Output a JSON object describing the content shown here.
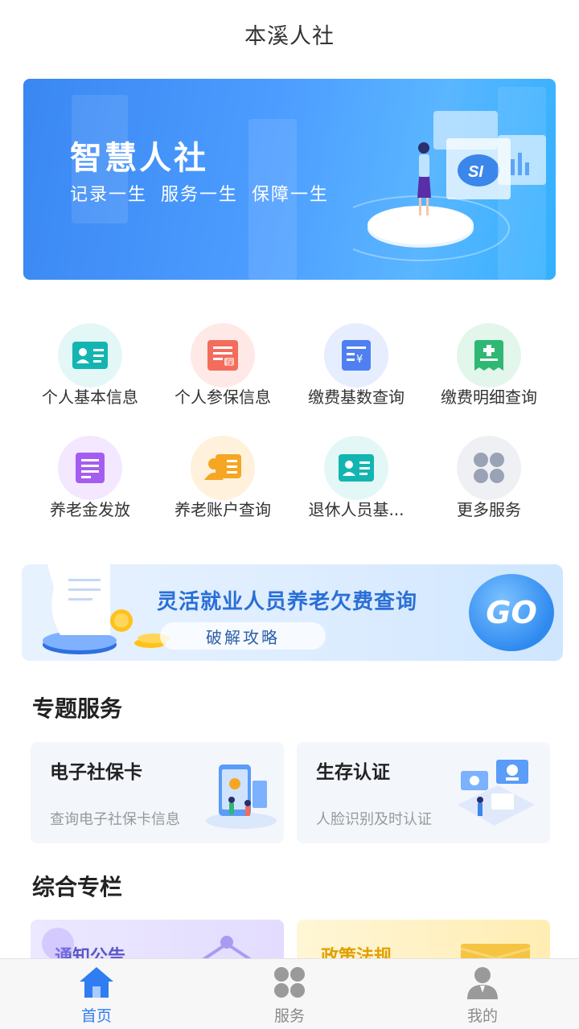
{
  "header": {
    "title": "本溪人社"
  },
  "banner": {
    "headline": "智慧人社",
    "slogan": "记录一生 服务一生 保障一生"
  },
  "services": [
    {
      "label": "个人基本信息",
      "icon": "id-card-icon",
      "bg": "#e3f7f7",
      "color": "#13b5b1"
    },
    {
      "label": "个人参保信息",
      "icon": "insurance-doc-icon",
      "bg": "#ffe9e6",
      "color": "#f36c5c"
    },
    {
      "label": "缴费基数查询",
      "icon": "payment-base-icon",
      "bg": "#e6edff",
      "color": "#4f7ff0"
    },
    {
      "label": "缴费明细查询",
      "icon": "payment-detail-icon",
      "bg": "#e2f6ec",
      "color": "#2fb873"
    },
    {
      "label": "养老金发放",
      "icon": "pension-payout-icon",
      "bg": "#f3e8ff",
      "color": "#a45df0"
    },
    {
      "label": "养老账户查询",
      "icon": "pension-account-icon",
      "bg": "#fff1dc",
      "color": "#f5a623"
    },
    {
      "label": "退休人员基...",
      "icon": "retiree-card-icon",
      "bg": "#e3f7f7",
      "color": "#13b5b1"
    },
    {
      "label": "更多服务",
      "icon": "more-services-icon",
      "bg": "#eef0f4",
      "color": "#9aa3b5"
    }
  ],
  "promo": {
    "title": "灵活就业人员养老欠费查询",
    "button": "破解攻略",
    "go": "GO"
  },
  "topics": {
    "title": "专题服务",
    "cards": [
      {
        "title": "电子社保卡",
        "subtitle": "查询电子社保卡信息"
      },
      {
        "title": "生存认证",
        "subtitle": "人脸识别及时认证"
      }
    ]
  },
  "columns": {
    "title": "综合专栏",
    "cards": [
      {
        "title": "通知公告",
        "color": "#5b58c9"
      },
      {
        "title": "政策法规",
        "color": "#e0a000"
      }
    ]
  },
  "tabbar": {
    "active_color": "#2f7df0",
    "inactive_color": "#8a8a8a",
    "tabs": [
      {
        "label": "首页",
        "icon": "home-icon"
      },
      {
        "label": "服务",
        "icon": "service-grid-icon"
      },
      {
        "label": "我的",
        "icon": "user-icon"
      }
    ]
  }
}
